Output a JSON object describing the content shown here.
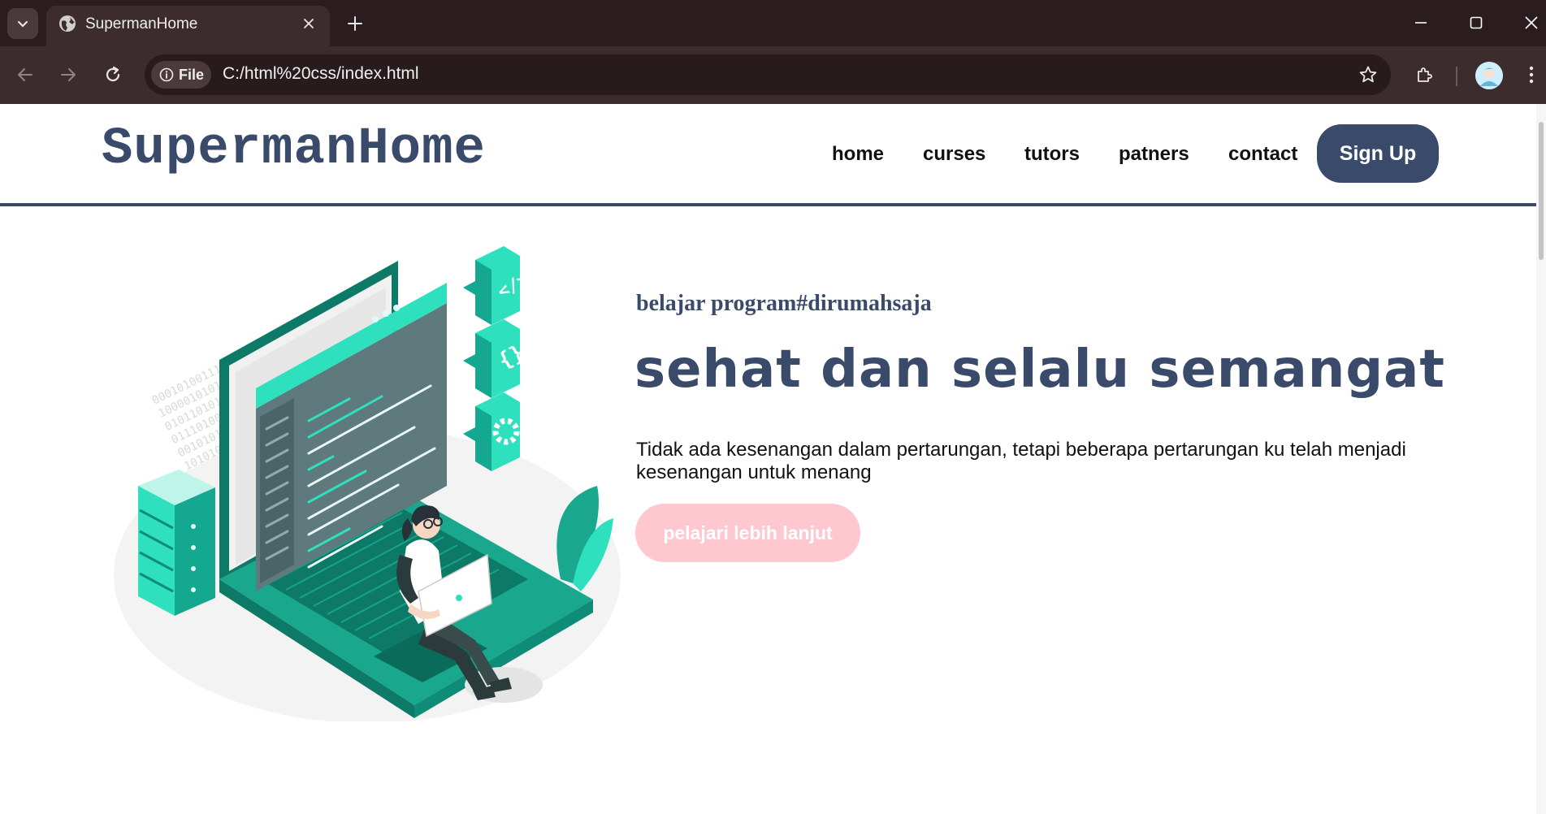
{
  "browser": {
    "tab_title": "SupermanHome",
    "chip_label": "File",
    "url": "C:/html%20css/index.html"
  },
  "site": {
    "logo": "SupermanHome",
    "nav": [
      "home",
      "curses",
      "tutors",
      "patners",
      "contact"
    ],
    "signup_label": "Sign Up"
  },
  "hero": {
    "tagline": "belajar program#dirumahsaja",
    "headline": "sehat dan selalu semangat",
    "description": "Tidak ada kesenangan dalam pertarungan, tetapi beberapa pertarungan ku telah menjadi kesenangan untuk menang",
    "cta_label": "pelajari lebih lanjut",
    "binary_lines": [
      "00010100111010101110101010001010101",
      "10000101011010010100101010110010101",
      "01011010101010001011010101110101010",
      "01110100010101110100101011010101011",
      "00101010101001010101110100101010101",
      "10101000101101010010101011001010101"
    ]
  },
  "colors": {
    "brand_navy": "#3a4a6b",
    "cta_pink": "#ffc8d0",
    "illustration_teal": "#19a88e",
    "chrome_dark": "#2b1d1f"
  },
  "icons": [
    "chevron-down-icon",
    "globe-icon",
    "close-icon",
    "plus-icon",
    "minimize-icon",
    "maximize-icon",
    "back-arrow-icon",
    "forward-arrow-icon",
    "reload-icon",
    "info-icon",
    "star-icon",
    "extensions-icon",
    "kebab-menu-icon"
  ]
}
